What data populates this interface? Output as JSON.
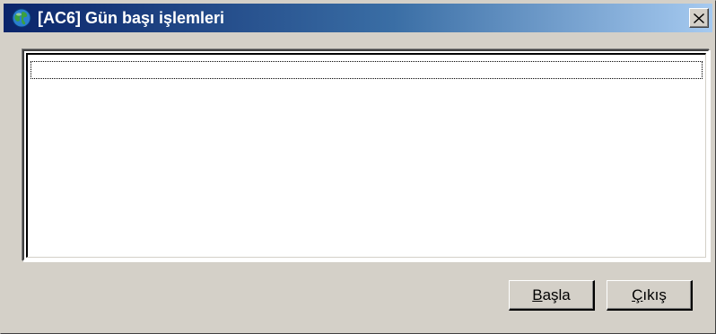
{
  "window": {
    "title": "[AC6] Gün başı işlemleri",
    "icon": "globe-icon",
    "close_symbol": "×"
  },
  "list": {
    "rows": [
      ""
    ]
  },
  "buttons": {
    "start": {
      "mnemonic": "B",
      "rest": "aşla"
    },
    "exit": {
      "mnemonic": "Ç",
      "rest": "ıkış"
    }
  },
  "colors": {
    "face": "#d4d0c8",
    "title_start": "#0a246a",
    "title_end": "#a6caf0"
  }
}
